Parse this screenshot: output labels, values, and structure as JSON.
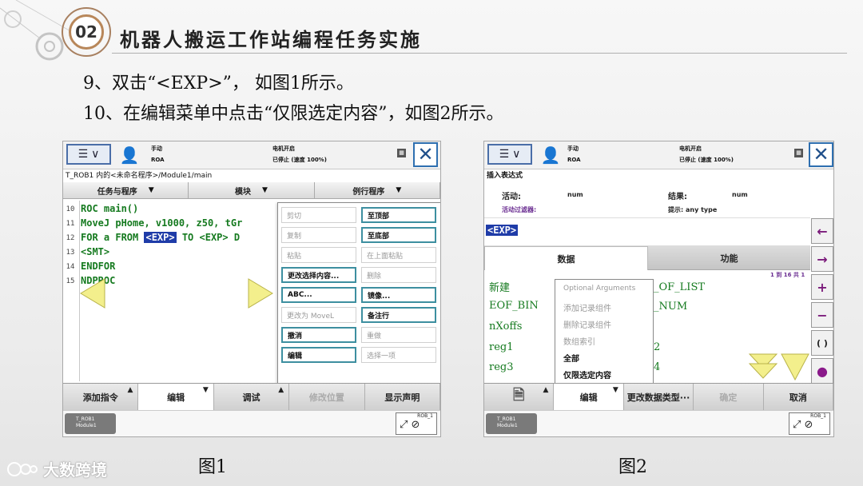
{
  "header": {
    "badge": "02",
    "title": "机器人搬运工作站编程任务实施"
  },
  "instructions": [
    "9、双击“<EXP>”， 如图1所示。",
    "10、在编辑菜单中点击“仅限选定内容”，如图2所示。"
  ],
  "captions": {
    "fig1": "图1",
    "fig2": "图2"
  },
  "watermark": "大数跨境",
  "fig1": {
    "status_top": {
      "mode": "手动",
      "robot": "ROA",
      "motor": "电机开启",
      "state": "已停止 (速度 100%)"
    },
    "breadcrumb": "T_ROB1 内的<未命名程序>/Module1/main",
    "columns": [
      "任务与程序",
      "模块",
      "例行程序"
    ],
    "code_lines": [
      {
        "n": "10",
        "text": "ROC main()"
      },
      {
        "n": "11",
        "text": " MoveJ pHome, v1000, z50, tGr"
      },
      {
        "n": "12",
        "pre": " FOR a FROM ",
        "sel": "<EXP>",
        "post": " TO <EXP> D"
      },
      {
        "n": "13",
        "text": "   <SMT>"
      },
      {
        "n": "14",
        "text": " ENDFOR"
      },
      {
        "n": "15",
        "text": "NDPROC"
      }
    ],
    "popup_left": [
      {
        "label": "剪切",
        "state": "off"
      },
      {
        "label": "复制",
        "state": "off"
      },
      {
        "label": "粘贴",
        "state": "off"
      },
      {
        "label": "更改选择内容...",
        "state": "on"
      },
      {
        "label": "ABC...",
        "state": "on"
      },
      {
        "label": "更改为 MoveL",
        "state": "off"
      },
      {
        "label": "撤消",
        "state": "on"
      },
      {
        "label": "编辑",
        "state": "on"
      }
    ],
    "popup_right": [
      {
        "label": "至顶部",
        "state": "on"
      },
      {
        "label": "至底部",
        "state": "on"
      },
      {
        "label": "在上面粘贴",
        "state": "off"
      },
      {
        "label": "删除",
        "state": "off"
      },
      {
        "label": "镜像...",
        "state": "on"
      },
      {
        "label": "备注行",
        "state": "on"
      },
      {
        "label": "重做",
        "state": "off"
      },
      {
        "label": "选择一项",
        "state": "off"
      }
    ],
    "bottom": [
      "添加指令",
      "编辑",
      "调试",
      "修改位置",
      "显示声明"
    ],
    "task": {
      "l1": "T_ROB1",
      "l2": "Module1"
    },
    "rob": "ROB_1"
  },
  "fig2": {
    "status_top": {
      "mode": "手动",
      "robot": "ROA",
      "motor": "电机开启",
      "state": "已停止 (速度 100%)"
    },
    "breadcrumb": "插入表达式",
    "active_label": "活动:",
    "active_val": "num",
    "result_label": "结果:",
    "result_val": "num",
    "filter_label": "活动过滤器:",
    "hint": "提示: any type",
    "expr": "<EXP>",
    "tabs": [
      "数据",
      "功能"
    ],
    "page_info": "1 到 16 共 1",
    "vars_left": [
      "新建",
      "EOF_BIN",
      "nXoffs",
      "reg1",
      "reg3"
    ],
    "vars_right": [
      "_OF_LIST",
      "_NUM",
      "",
      "2",
      "4"
    ],
    "context": [
      {
        "label": "Optional Arguments",
        "k": false
      },
      {
        "label": "添加记录组件",
        "k": false
      },
      {
        "label": "删除记录组件",
        "k": false
      },
      {
        "label": "数组索引",
        "k": false
      },
      {
        "label": "全部",
        "k": true
      },
      {
        "label": "仅限选定内容",
        "k": true
      }
    ],
    "side": [
      "←",
      "→",
      "+",
      "−",
      "( )",
      "●"
    ],
    "bottom": [
      "",
      "编辑",
      "更改数据类型···",
      "确定",
      "取消"
    ],
    "task": {
      "l1": "T_ROB1",
      "l2": "Module1"
    },
    "rob": "ROB_1"
  }
}
